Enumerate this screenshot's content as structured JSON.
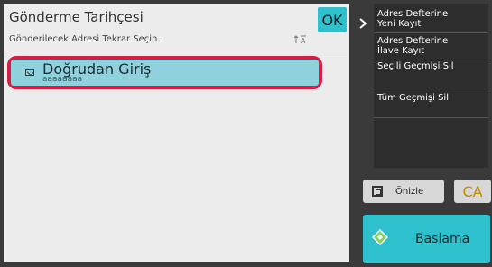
{
  "left_panel": {
    "title": "Gönderme Tarihçesi",
    "ok_label": "OK",
    "subtitle": "Gönderilecek Adresi Tekrar Seçin.",
    "sort_icon": "sort-az-icon",
    "items": [
      {
        "name": "Doğrudan Giriş",
        "sub": "aaaaaaaa",
        "icon": "mail-icon"
      }
    ]
  },
  "right_menu": {
    "items": [
      {
        "line1": "Adres Defterine",
        "line2": "Yeni Kayıt"
      },
      {
        "line1": "Adres Defterine",
        "line2": "İlave Kayıt"
      },
      {
        "line1": "Seçili Geçmişi Sil",
        "line2": ""
      },
      {
        "line1": "Tüm Geçmişi Sil",
        "line2": ""
      }
    ]
  },
  "preview_label": "Önizle",
  "ca_label": "CA",
  "start_label": "Baslama",
  "colors": {
    "accent": "#2ec0cc",
    "highlight": "#8fd1dc",
    "selection_outline": "#d51e46",
    "ca_text": "#c58c00"
  }
}
